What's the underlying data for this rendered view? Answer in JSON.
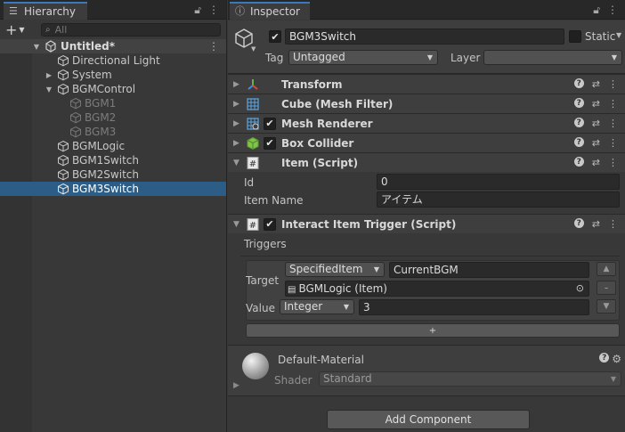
{
  "hierarchy": {
    "tab_title": "Hierarchy",
    "search_placeholder": "All",
    "items": [
      {
        "label": "Untitled*"
      },
      {
        "label": "Directional Light"
      },
      {
        "label": "System"
      },
      {
        "label": "BGMControl"
      },
      {
        "label": "BGM1"
      },
      {
        "label": "BGM2"
      },
      {
        "label": "BGM3"
      },
      {
        "label": "BGMLogic"
      },
      {
        "label": "BGM1Switch"
      },
      {
        "label": "BGM2Switch"
      },
      {
        "label": "BGM3Switch"
      }
    ],
    "selected": "BGM3Switch"
  },
  "inspector": {
    "tab_title": "Inspector",
    "object_name": "BGM3Switch",
    "active": true,
    "static_label": "Static",
    "tag_label": "Tag",
    "tag_value": "Untagged",
    "layer_label": "Layer",
    "layer_value": "",
    "components": [
      {
        "name": "Transform"
      },
      {
        "name": "Cube (Mesh Filter)"
      },
      {
        "name": "Mesh Renderer",
        "enabled": true
      },
      {
        "name": "Box Collider",
        "enabled": true
      },
      {
        "name": "Item (Script)"
      },
      {
        "name": "Interact Item Trigger (Script)",
        "enabled": true
      }
    ],
    "item_script": {
      "id_label": "Id",
      "id_value": "0",
      "item_name_label": "Item Name",
      "item_name_value": "アイテム"
    },
    "interact_trigger": {
      "triggers_label": "Triggers",
      "target_label": "Target",
      "target_mode": "SpecifiedItem",
      "target_name": "CurrentBGM",
      "target_object": "BGMLogic (Item)",
      "value_label": "Value",
      "value_type": "Integer",
      "value": "3",
      "add_label": "+",
      "remove_label": "-"
    },
    "material": {
      "name": "Default-Material",
      "shader_label": "Shader",
      "shader_value": "Standard"
    },
    "add_component_label": "Add Component"
  },
  "colors": {
    "selection": "#2c5d87",
    "panel_bg": "#383838",
    "header_bg": "#3e3e3e",
    "tab_accent": "#3a79bb"
  }
}
